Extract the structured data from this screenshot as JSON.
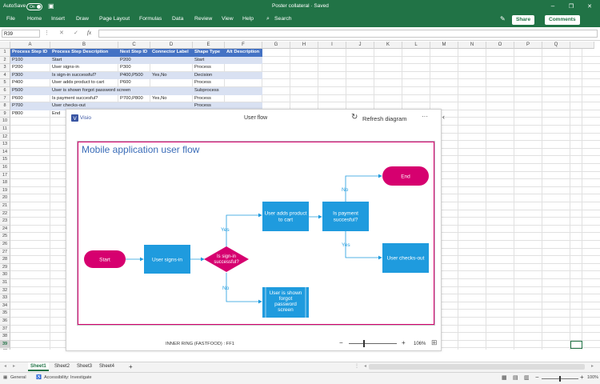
{
  "title_bar": {
    "autosave_label": "AutoSave",
    "autosave_state": "On",
    "document_title": "Poster collateral  ·  Saved",
    "window_controls": [
      "minimize-icon",
      "restore-icon",
      "close-icon"
    ]
  },
  "menu": {
    "items": [
      "File",
      "Home",
      "Insert",
      "Draw",
      "Page Layout",
      "Formulas",
      "Data",
      "Review",
      "View",
      "Help"
    ],
    "search_label": "Search",
    "share_label": "Share",
    "comments_label": "Comments"
  },
  "formula_bar": {
    "name_box": "R39",
    "fx": "fx",
    "cancel": "✕",
    "enter": "✓",
    "value": ""
  },
  "sheet": {
    "columns": [
      "A",
      "B",
      "C",
      "D",
      "E",
      "F",
      "G",
      "H",
      "I",
      "J",
      "K",
      "L",
      "M",
      "N",
      "O",
      "P",
      "Q",
      "R"
    ],
    "selected_column": "R",
    "selected_row": 39,
    "row_count": 41,
    "headers": [
      "Process Step ID",
      "Process Step Description",
      "Next Step ID",
      "Connector Label",
      "Shape Type",
      "Alt Description"
    ],
    "rows": [
      [
        "P100",
        "Start",
        "P200",
        "",
        "Start",
        ""
      ],
      [
        "P200",
        "User signs-in",
        "P300",
        "",
        "Process",
        ""
      ],
      [
        "P300",
        "Is sign-in successful?",
        "P400,P500",
        "Yes,No",
        "Decision",
        ""
      ],
      [
        "P400",
        "User adds product to cart",
        "P600",
        "",
        "Process",
        ""
      ],
      [
        "P500",
        "User is shown forgot password screen",
        "",
        "",
        "Subprocess",
        ""
      ],
      [
        "P600",
        "Is payment succesful?",
        "P700,P800",
        "Yes,No",
        "Process",
        ""
      ],
      [
        "P700",
        "User checks-out",
        "",
        "",
        "Process",
        ""
      ],
      [
        "P800",
        "End",
        "",
        "",
        "End",
        ""
      ]
    ],
    "header_color": "#4472c4",
    "band_color": "#d9e1f2"
  },
  "visio_panel": {
    "app_label": "Visio",
    "title": "User flow",
    "refresh_label": "Refresh diagram",
    "more_label": "···",
    "collapse_label": "‹",
    "status_text": "INNER RING (FASTFOOD) : FF1",
    "zoom_minus": "−",
    "zoom_plus": "+",
    "zoom_level": "106%",
    "zoom_fraction": 0.3
  },
  "diagram": {
    "title": "Mobile application user flow",
    "frame_color": "#d6006f",
    "process_color": "#1f9bde",
    "terminal_color": "#d6006f",
    "nodes": {
      "start": "Start",
      "signin": "User signs-in",
      "decision": "Is sign-in successful?",
      "cart": "User adds product to cart",
      "payment": "Is payment succesful?",
      "end": "End",
      "checkout": "User checks-out",
      "forgot": "User is shown forgot password screen"
    },
    "edges": {
      "yes1": "Yes",
      "no1": "No",
      "yes2": "Yes",
      "no2": "No"
    }
  },
  "tabs": {
    "sheets": [
      "Sheet1",
      "Sheet2",
      "Sheet3",
      "Sheet4"
    ],
    "active": "Sheet1",
    "add": "+"
  },
  "status": {
    "mode": "General",
    "accessibility": "Accessibility: Investigate",
    "zoom": "100%"
  }
}
